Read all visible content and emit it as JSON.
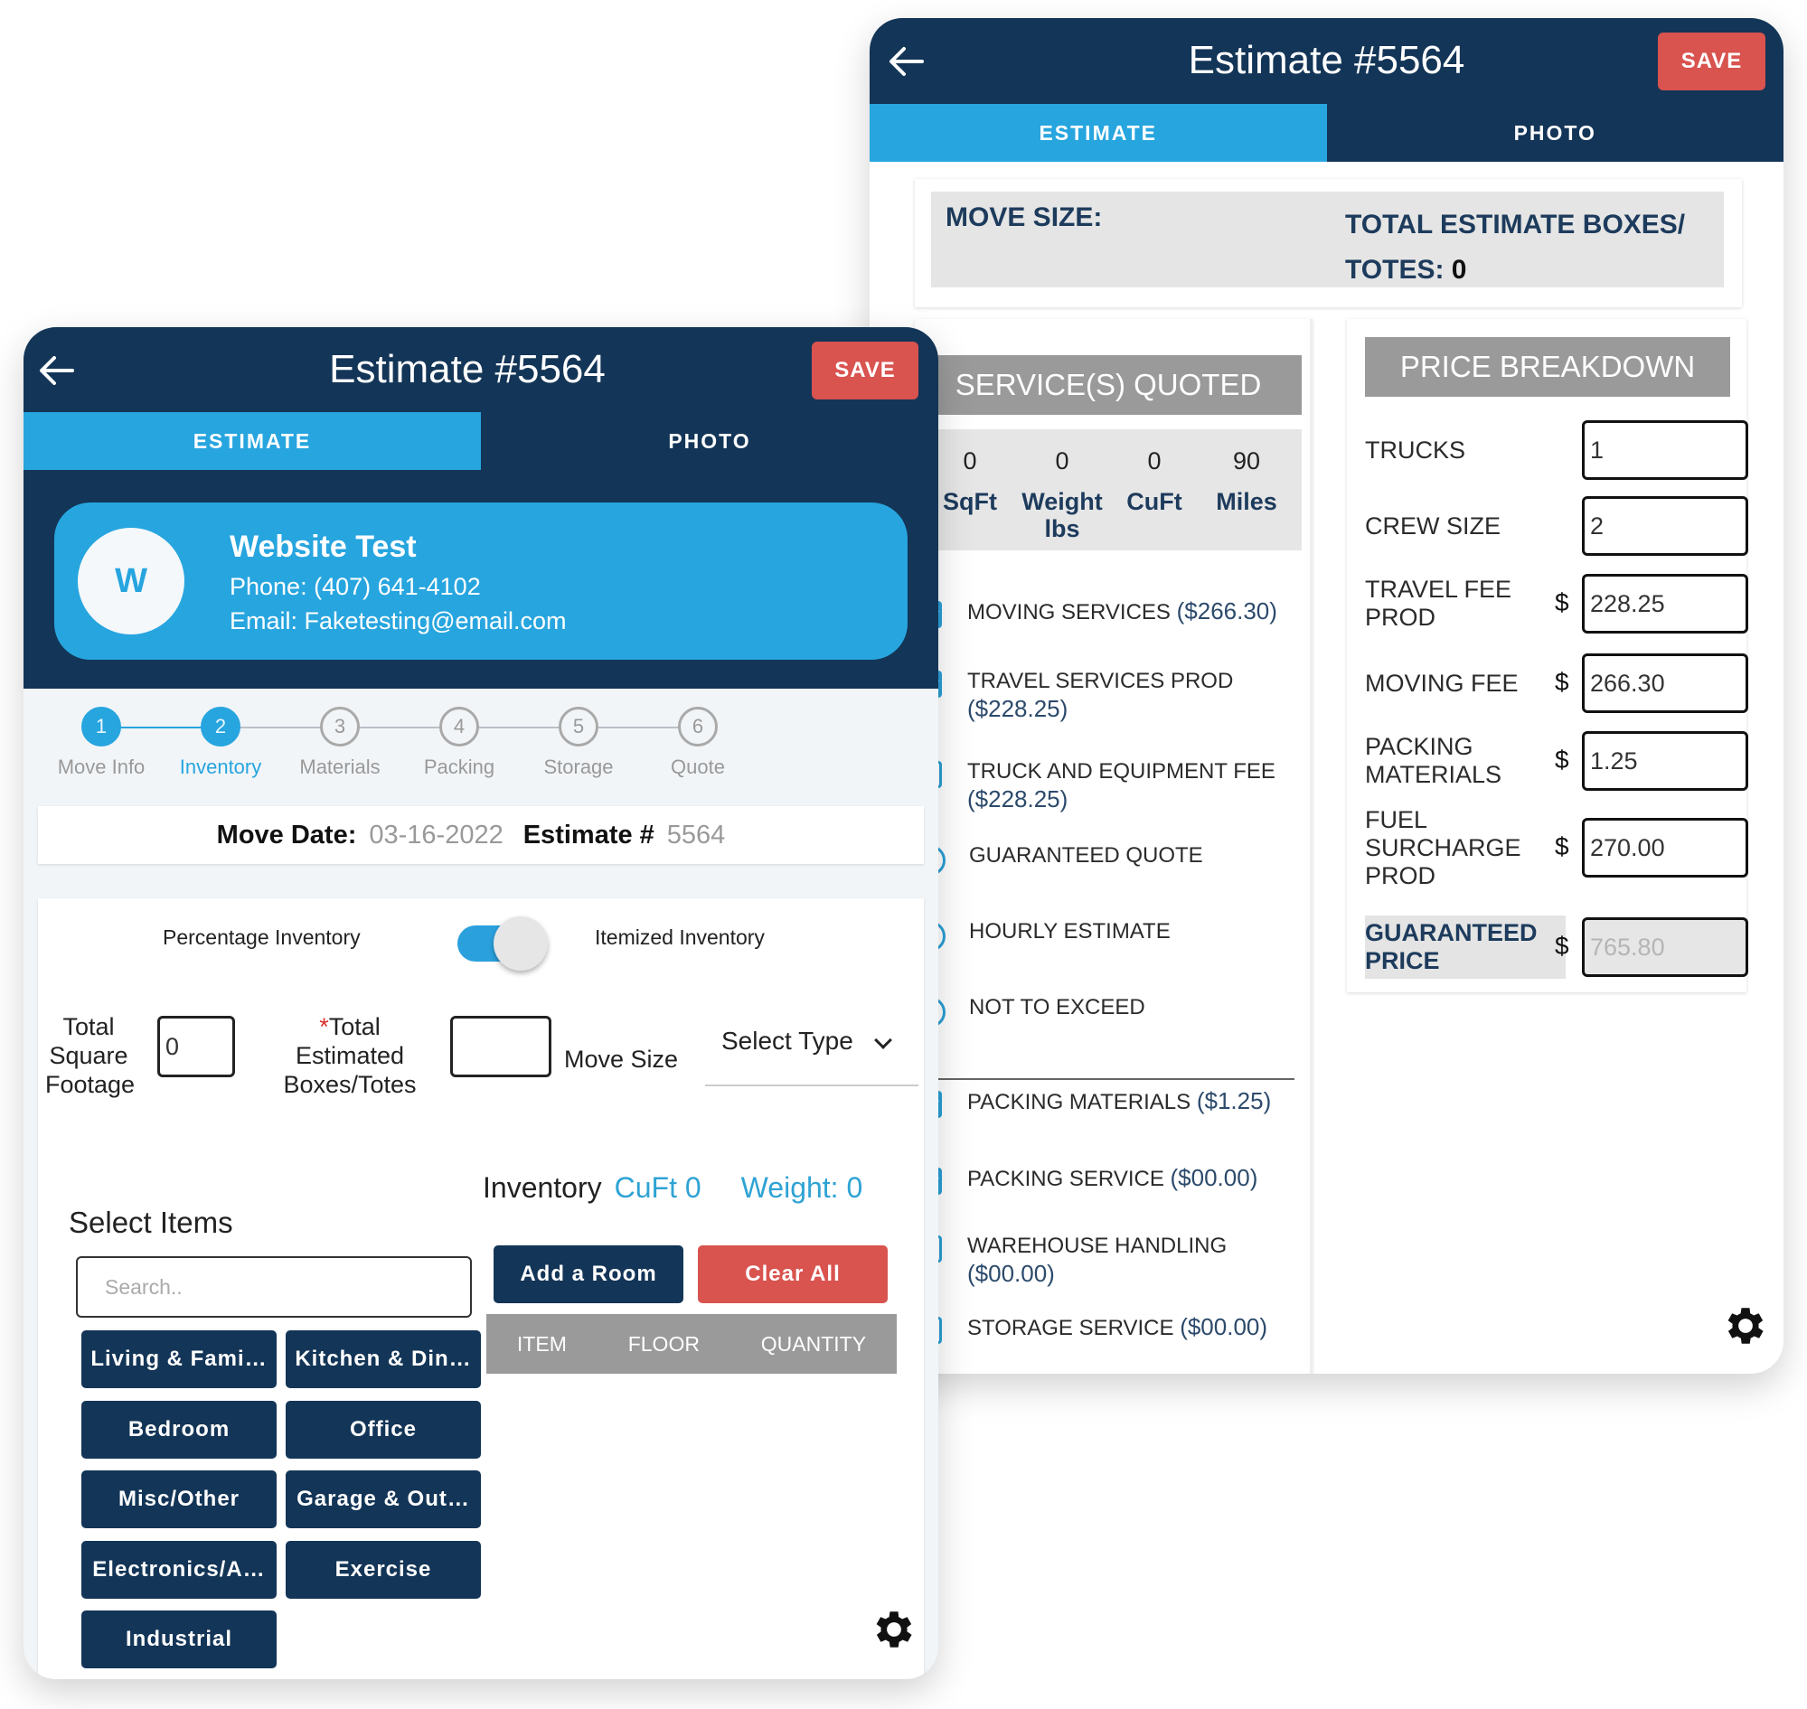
{
  "right_screen": {
    "title": "Estimate #5564",
    "save_label": "SAVE",
    "tabs": [
      {
        "label": "ESTIMATE",
        "active": true
      },
      {
        "label": "PHOTO",
        "active": false
      }
    ],
    "move_size_label": "MOVE SIZE:",
    "total_boxes_label": "TOTAL ESTIMATE BOXES/",
    "totes_label": "TOTES:",
    "totes_value": "0",
    "services_header": "SERVICE(S) QUOTED",
    "stats": [
      {
        "value": "0",
        "label": "SqFt"
      },
      {
        "value": "0",
        "label": "Weight lbs"
      },
      {
        "value": "0",
        "label": "CuFt"
      },
      {
        "value": "90",
        "label": "Miles"
      }
    ],
    "services": [
      {
        "type": "checkbox",
        "checked": true,
        "label": "MOVING SERVICES",
        "amount": "($266.30)"
      },
      {
        "type": "checkbox",
        "checked": true,
        "label": "TRAVEL SERVICES PROD",
        "amount": "($228.25)"
      },
      {
        "type": "checkbox",
        "checked": false,
        "label": "TRUCK AND EQUIPMENT FEE",
        "amount": "($228.25)"
      },
      {
        "type": "radio",
        "checked": true,
        "label": "GUARANTEED QUOTE"
      },
      {
        "type": "radio",
        "checked": false,
        "label": "HOURLY ESTIMATE"
      },
      {
        "type": "radio",
        "checked": false,
        "label": "NOT TO EXCEED"
      },
      {
        "type": "checkbox",
        "checked": true,
        "label": "PACKING MATERIALS",
        "amount": "($1.25)"
      },
      {
        "type": "checkbox",
        "checked": true,
        "label": "PACKING SERVICE",
        "amount": "($00.00)"
      },
      {
        "type": "checkbox",
        "checked": false,
        "label": "WAREHOUSE HANDLING",
        "amount": "($00.00)"
      },
      {
        "type": "checkbox",
        "checked": false,
        "label": "STORAGE SERVICE",
        "amount": "($00.00)"
      }
    ],
    "price_header": "PRICE BREAKDOWN",
    "currency_symbol": "$",
    "price_rows": [
      {
        "label": "TRUCKS",
        "value": "1"
      },
      {
        "label": "CREW SIZE",
        "value": "2"
      },
      {
        "label": "TRAVEL FEE PROD",
        "value": "228.25"
      },
      {
        "label": "MOVING FEE",
        "value": "266.30"
      },
      {
        "label": "PACKING MATERIALS",
        "value": "1.25"
      },
      {
        "label": "FUEL SURCHARGE PROD",
        "value": "270.00"
      },
      {
        "label": "GUARANTEED PRICE",
        "value": "765.80"
      }
    ]
  },
  "left_screen": {
    "title": "Estimate #5564",
    "save_label": "SAVE",
    "tabs": [
      {
        "label": "ESTIMATE",
        "active": true
      },
      {
        "label": "PHOTO",
        "active": false
      }
    ],
    "customer": {
      "initial": "W",
      "name": "Website Test",
      "phone": "Phone: (407) 641-4102",
      "email": "Email: Faketesting@email.com"
    },
    "steps": [
      {
        "num": "1",
        "label": "Move Info",
        "state": "done"
      },
      {
        "num": "2",
        "label": "Inventory",
        "state": "current"
      },
      {
        "num": "3",
        "label": "Materials",
        "state": "todo"
      },
      {
        "num": "4",
        "label": "Packing",
        "state": "todo"
      },
      {
        "num": "5",
        "label": "Storage",
        "state": "todo"
      },
      {
        "num": "6",
        "label": "Quote",
        "state": "todo"
      }
    ],
    "move_date_label": "Move Date:",
    "move_date": "03-16-2022",
    "estimate_no_label": "Estimate #",
    "estimate_no": "5564",
    "toggle_left_label": "Percentage Inventory",
    "toggle_right_label": "Itemized Inventory",
    "toggle_on": true,
    "sqft_label_lines": [
      "Total",
      "Square",
      "Footage"
    ],
    "sqft_value": "0",
    "boxes_required_mark": "*",
    "boxes_label_lines": [
      "Total",
      "Estimated",
      "Boxes/Totes"
    ],
    "boxes_value": "",
    "move_size_label": "Move Size",
    "move_size_select": "Select Type",
    "inventory_label": "Inventory",
    "cuft_label": "CuFt 0",
    "weight_label": "Weight: 0",
    "select_items_label": "Select Items",
    "search_placeholder": "Search..",
    "rooms": [
      "Living & Fami…",
      "Kitchen & Din…",
      "Bedroom",
      "Office",
      "Misc/Other",
      "Garage & Out…",
      "Electronics/A…",
      "Exercise",
      "Industrial"
    ],
    "add_room_label": "Add a Room",
    "clear_all_label": "Clear All",
    "table_headers": [
      "ITEM",
      "FLOOR",
      "QUANTITY"
    ]
  },
  "colors": {
    "navy": "#133557",
    "accent_blue": "#27a5df",
    "save_red": "#d9534f",
    "header_gray": "#9a9a9a"
  }
}
